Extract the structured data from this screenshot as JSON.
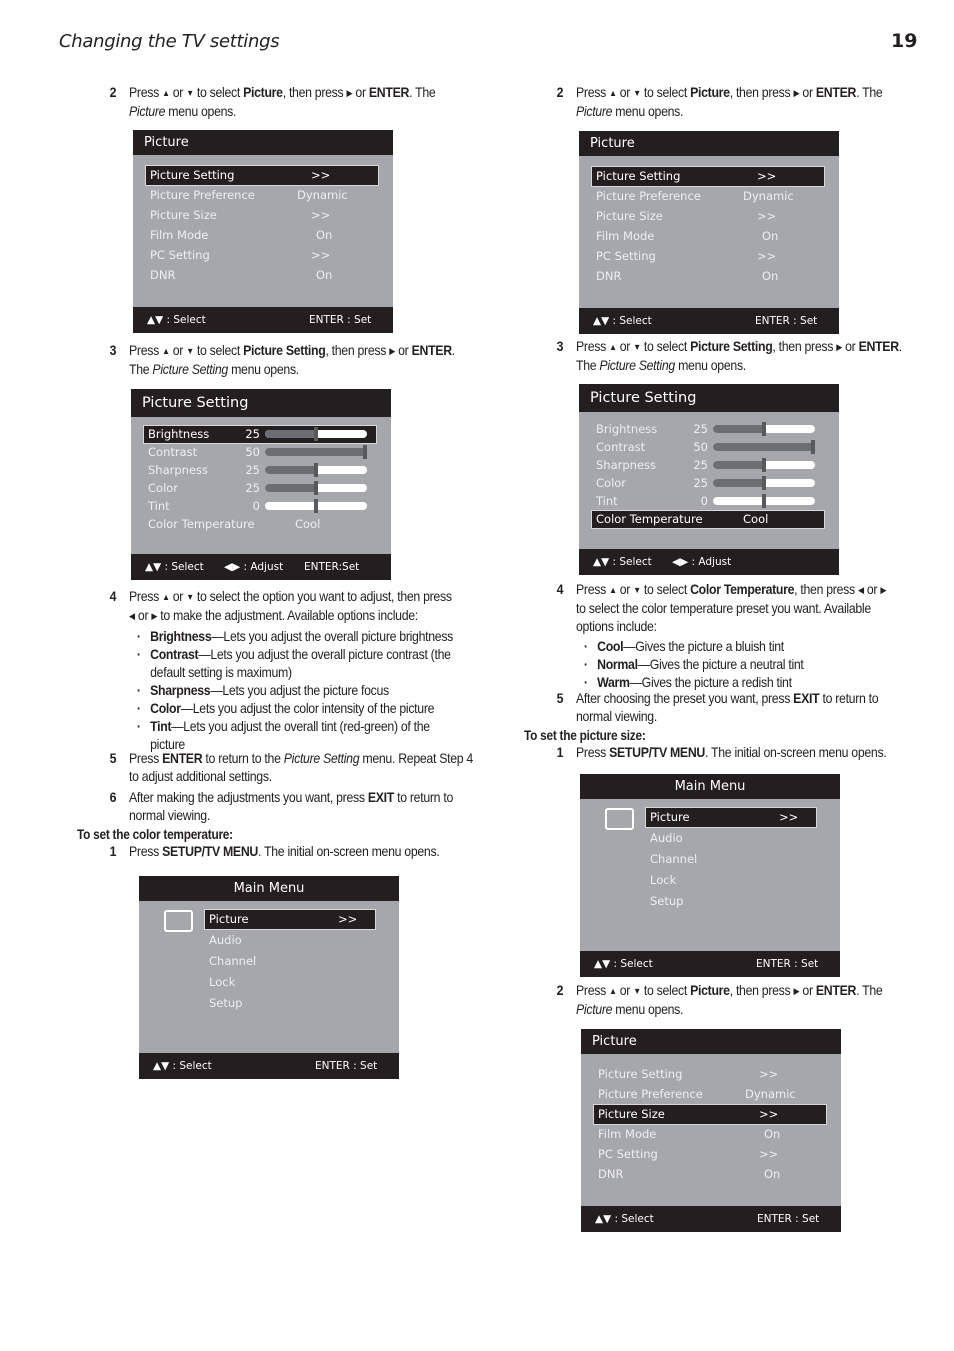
{
  "header": {
    "title": "Changing the TV settings",
    "page_number": "19"
  },
  "left": {
    "step2": {
      "num": "2",
      "press": "Press",
      "or1": "or",
      "to_select": "to select",
      "target": "Picture",
      "then_press": ", then press",
      "or2": "or",
      "enter": "ENTER",
      "the": ". The",
      "menu_name": "Picture",
      "menu_opens": "menu opens."
    },
    "picture_menu": {
      "title": "Picture",
      "rows": [
        {
          "label": "Picture Setting",
          "value": ">>"
        },
        {
          "label": "Picture Preference",
          "value": "Dynamic"
        },
        {
          "label": "Picture Size",
          "value": ">>"
        },
        {
          "label": "Film Mode",
          "value": "On"
        },
        {
          "label": "PC Setting",
          "value": ">>"
        },
        {
          "label": "DNR",
          "value": "On"
        }
      ],
      "selected": "Picture Setting",
      "footer": {
        "select": "▲▼ : Select",
        "set": "ENTER : Set"
      }
    },
    "step3": {
      "num": "3",
      "press": "Press",
      "or1": "or",
      "to_select": "to select",
      "target": "Picture Setting",
      "then_press": ", then press",
      "or2": "or",
      "enter": "ENTER",
      "the": ".",
      "line2_the": "The",
      "menu_name": "Picture Setting",
      "menu_opens": "menu opens."
    },
    "picture_setting_menu": {
      "title": "Picture Setting",
      "sliders": [
        {
          "label": "Brightness",
          "value": "25",
          "fraction": 0.5
        },
        {
          "label": "Contrast",
          "value": "50",
          "fraction": 1.0
        },
        {
          "label": "Sharpness",
          "value": "25",
          "fraction": 0.5
        },
        {
          "label": "Color",
          "value": "25",
          "fraction": 0.5
        },
        {
          "label": "Tint",
          "value": "0",
          "fraction": 0.5
        }
      ],
      "color_temp": {
        "label": "Color Temperature",
        "value": "Cool"
      },
      "selected": "Brightness",
      "footer": {
        "select": "▲▼ : Select",
        "adjust": "◀▶ : Adjust",
        "set": "ENTER:Set"
      }
    },
    "step4": {
      "num": "4",
      "line1": "to select the option you want to adjust, then press",
      "line2": "to make the adjustment. Available options include:",
      "press": "Press",
      "or": "or",
      "bullets": [
        {
          "term": "Brightness",
          "desc": "—Lets you adjust the overall picture brightness"
        },
        {
          "term": "Contrast",
          "desc": "—Lets you adjust the overall picture contrast (the",
          "cont": "default setting is maximum)"
        },
        {
          "term": "Sharpness",
          "desc": "—Lets you adjust the picture focus"
        },
        {
          "term": "Color",
          "desc": "—Lets you adjust the color intensity of the picture"
        },
        {
          "term": "Tint",
          "desc": "—Lets you adjust the overall tint (red-green) of the",
          "cont": "picture"
        }
      ]
    },
    "step5": {
      "num": "5",
      "press": "Press",
      "enter": "ENTER",
      "to_return": "to return to the",
      "menu_name": "Picture Setting",
      "rest": "menu. Repeat Step 4",
      "line2": "to adjust additional settings."
    },
    "step6": {
      "num": "6",
      "text": "After making the adjustments you want, press",
      "exit": "EXIT",
      "rest": "to return to",
      "line2": "normal viewing."
    },
    "section": "To set the color temperature:",
    "step1": {
      "num": "1",
      "press": "Press",
      "key": "SETUP/TV MENU",
      "rest": ". The initial on-screen menu opens."
    },
    "main_menu": {
      "title": "Main Menu",
      "items": [
        {
          "label": "Picture",
          "value": ">>"
        },
        {
          "label": "Audio"
        },
        {
          "label": "Channel"
        },
        {
          "label": "Lock"
        },
        {
          "label": "Setup"
        }
      ],
      "selected": "Picture",
      "footer": {
        "select": "▲▼ : Select",
        "set": "ENTER : Set"
      }
    }
  },
  "right": {
    "step2": {
      "num": "2",
      "press": "Press",
      "or1": "or",
      "to_select": "to select",
      "target": "Picture",
      "then_press": ", then press",
      "or2": "or",
      "enter": "ENTER",
      "the": ". The",
      "menu_name": "Picture",
      "menu_opens": "menu opens."
    },
    "picture_menu": {
      "title": "Picture",
      "rows": [
        {
          "label": "Picture Setting",
          "value": ">>"
        },
        {
          "label": "Picture Preference",
          "value": "Dynamic"
        },
        {
          "label": "Picture Size",
          "value": ">>"
        },
        {
          "label": "Film Mode",
          "value": "On"
        },
        {
          "label": "PC Setting",
          "value": ">>"
        },
        {
          "label": "DNR",
          "value": "On"
        }
      ],
      "selected": "Picture Setting",
      "footer": {
        "select": "▲▼ : Select",
        "set": "ENTER : Set"
      }
    },
    "step3": {
      "num": "3",
      "press": "Press",
      "or1": "or",
      "to_select": "to select",
      "target": "Picture Setting",
      "then_press": ", then press",
      "or2": "or",
      "enter": "ENTER",
      "the": ".",
      "line2_the": "The",
      "menu_name": "Picture Setting",
      "menu_opens": "menu opens."
    },
    "picture_setting_menu": {
      "title": "Picture Setting",
      "sliders": [
        {
          "label": "Brightness",
          "value": "25",
          "fraction": 0.5
        },
        {
          "label": "Contrast",
          "value": "50",
          "fraction": 1.0
        },
        {
          "label": "Sharpness",
          "value": "25",
          "fraction": 0.5
        },
        {
          "label": "Color",
          "value": "25",
          "fraction": 0.5
        },
        {
          "label": "Tint",
          "value": "0",
          "fraction": 0.5
        }
      ],
      "color_temp": {
        "label": "Color Temperature",
        "value": "Cool"
      },
      "selected": "Color Temperature",
      "footer": {
        "select": "▲▼ : Select",
        "adjust": "◀▶ : Adjust"
      }
    },
    "step4": {
      "num": "4",
      "press": "Press",
      "or": "or",
      "to_select": "to select",
      "target": "Color Temperature",
      "then_press": ", then press",
      "line2": "to select the color temperature preset you want. Available",
      "line3": "options include:",
      "bullets": [
        {
          "term": "Cool",
          "desc": "—Gives the picture a bluish tint"
        },
        {
          "term": "Normal",
          "desc": "—Gives the picture a neutral tint"
        },
        {
          "term": "Warm",
          "desc": "—Gives the picture a redish tint"
        }
      ]
    },
    "step5": {
      "num": "5",
      "text": "After choosing the preset you want, press",
      "exit": "EXIT",
      "rest": "to return to",
      "line2": "normal viewing."
    },
    "section": "To set the picture size:",
    "step1": {
      "num": "1",
      "press": "Press",
      "key": "SETUP/TV MENU",
      "rest": ". The initial on-screen menu opens."
    },
    "main_menu": {
      "title": "Main Menu",
      "items": [
        {
          "label": "Picture",
          "value": ">>"
        },
        {
          "label": "Audio"
        },
        {
          "label": "Channel"
        },
        {
          "label": "Lock"
        },
        {
          "label": "Setup"
        }
      ],
      "selected": "Picture",
      "footer": {
        "select": "▲▼ : Select",
        "set": "ENTER : Set"
      }
    },
    "step2b": {
      "num": "2",
      "press": "Press",
      "or1": "or",
      "to_select": "to select",
      "target": "Picture",
      "then_press": ", then press",
      "or2": "or",
      "enter": "ENTER",
      "the": ". The",
      "menu_name": "Picture",
      "menu_opens": "menu opens."
    },
    "picture_menu_b": {
      "title": "Picture",
      "rows": [
        {
          "label": "Picture Setting",
          "value": ">>"
        },
        {
          "label": "Picture Preference",
          "value": "Dynamic"
        },
        {
          "label": "Picture Size",
          "value": ">>"
        },
        {
          "label": "Film Mode",
          "value": "On"
        },
        {
          "label": "PC Setting",
          "value": ">>"
        },
        {
          "label": "DNR",
          "value": "On"
        }
      ],
      "selected": "Picture Size",
      "footer": {
        "select": "▲▼ : Select",
        "set": "ENTER : Set"
      }
    }
  },
  "colors": {
    "osd_bg": "#a5a7aa",
    "osd_bar": "#231f20",
    "text": "#231f20"
  }
}
